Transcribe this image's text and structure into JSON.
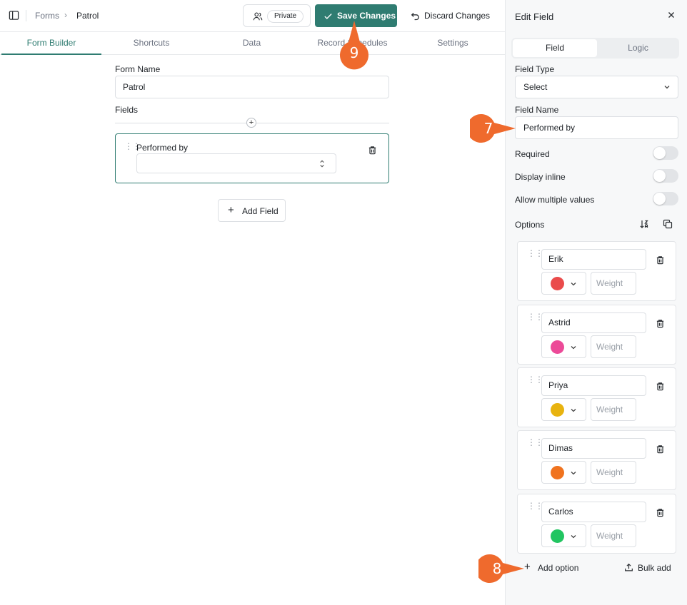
{
  "breadcrumb": {
    "root": "Forms",
    "separator": "›",
    "current": "Patrol"
  },
  "toolbar": {
    "private_label": "Private",
    "save_label": "Save Changes",
    "discard_label": "Discard Changes"
  },
  "tabs": [
    {
      "label": "Form Builder",
      "active": true
    },
    {
      "label": "Shortcuts",
      "active": false
    },
    {
      "label": "Data",
      "active": false
    },
    {
      "label": "Record Schedules",
      "active": false
    },
    {
      "label": "Settings",
      "active": false
    }
  ],
  "builder": {
    "form_name_label": "Form Name",
    "form_name_value": "Patrol",
    "fields_label": "Fields",
    "field": {
      "label": "Performed by",
      "value": ""
    },
    "add_field_label": "Add Field"
  },
  "panel": {
    "title": "Edit Field",
    "segment": {
      "field": "Field",
      "logic": "Logic"
    },
    "field_type_label": "Field Type",
    "field_type_value": "Select",
    "field_name_label": "Field Name",
    "field_name_value": "Performed by",
    "toggles": [
      {
        "label": "Required",
        "on": false
      },
      {
        "label": "Display inline",
        "on": false
      },
      {
        "label": "Allow multiple values",
        "on": false
      }
    ],
    "options_label": "Options",
    "options": [
      {
        "name": "Erik",
        "color": "#ea4b4b",
        "weight_placeholder": "Weight"
      },
      {
        "name": "Astrid",
        "color": "#ec4a98",
        "weight_placeholder": "Weight"
      },
      {
        "name": "Priya",
        "color": "#e8b30f",
        "weight_placeholder": "Weight"
      },
      {
        "name": "Dimas",
        "color": "#f0731f",
        "weight_placeholder": "Weight"
      },
      {
        "name": "Carlos",
        "color": "#22c561",
        "weight_placeholder": "Weight"
      }
    ],
    "add_option_label": "Add option",
    "bulk_add_label": "Bulk add"
  },
  "annotations": [
    "9",
    "7",
    "8"
  ],
  "colors": {
    "accent": "#2f7c71",
    "marker": "#ef6a2d"
  }
}
